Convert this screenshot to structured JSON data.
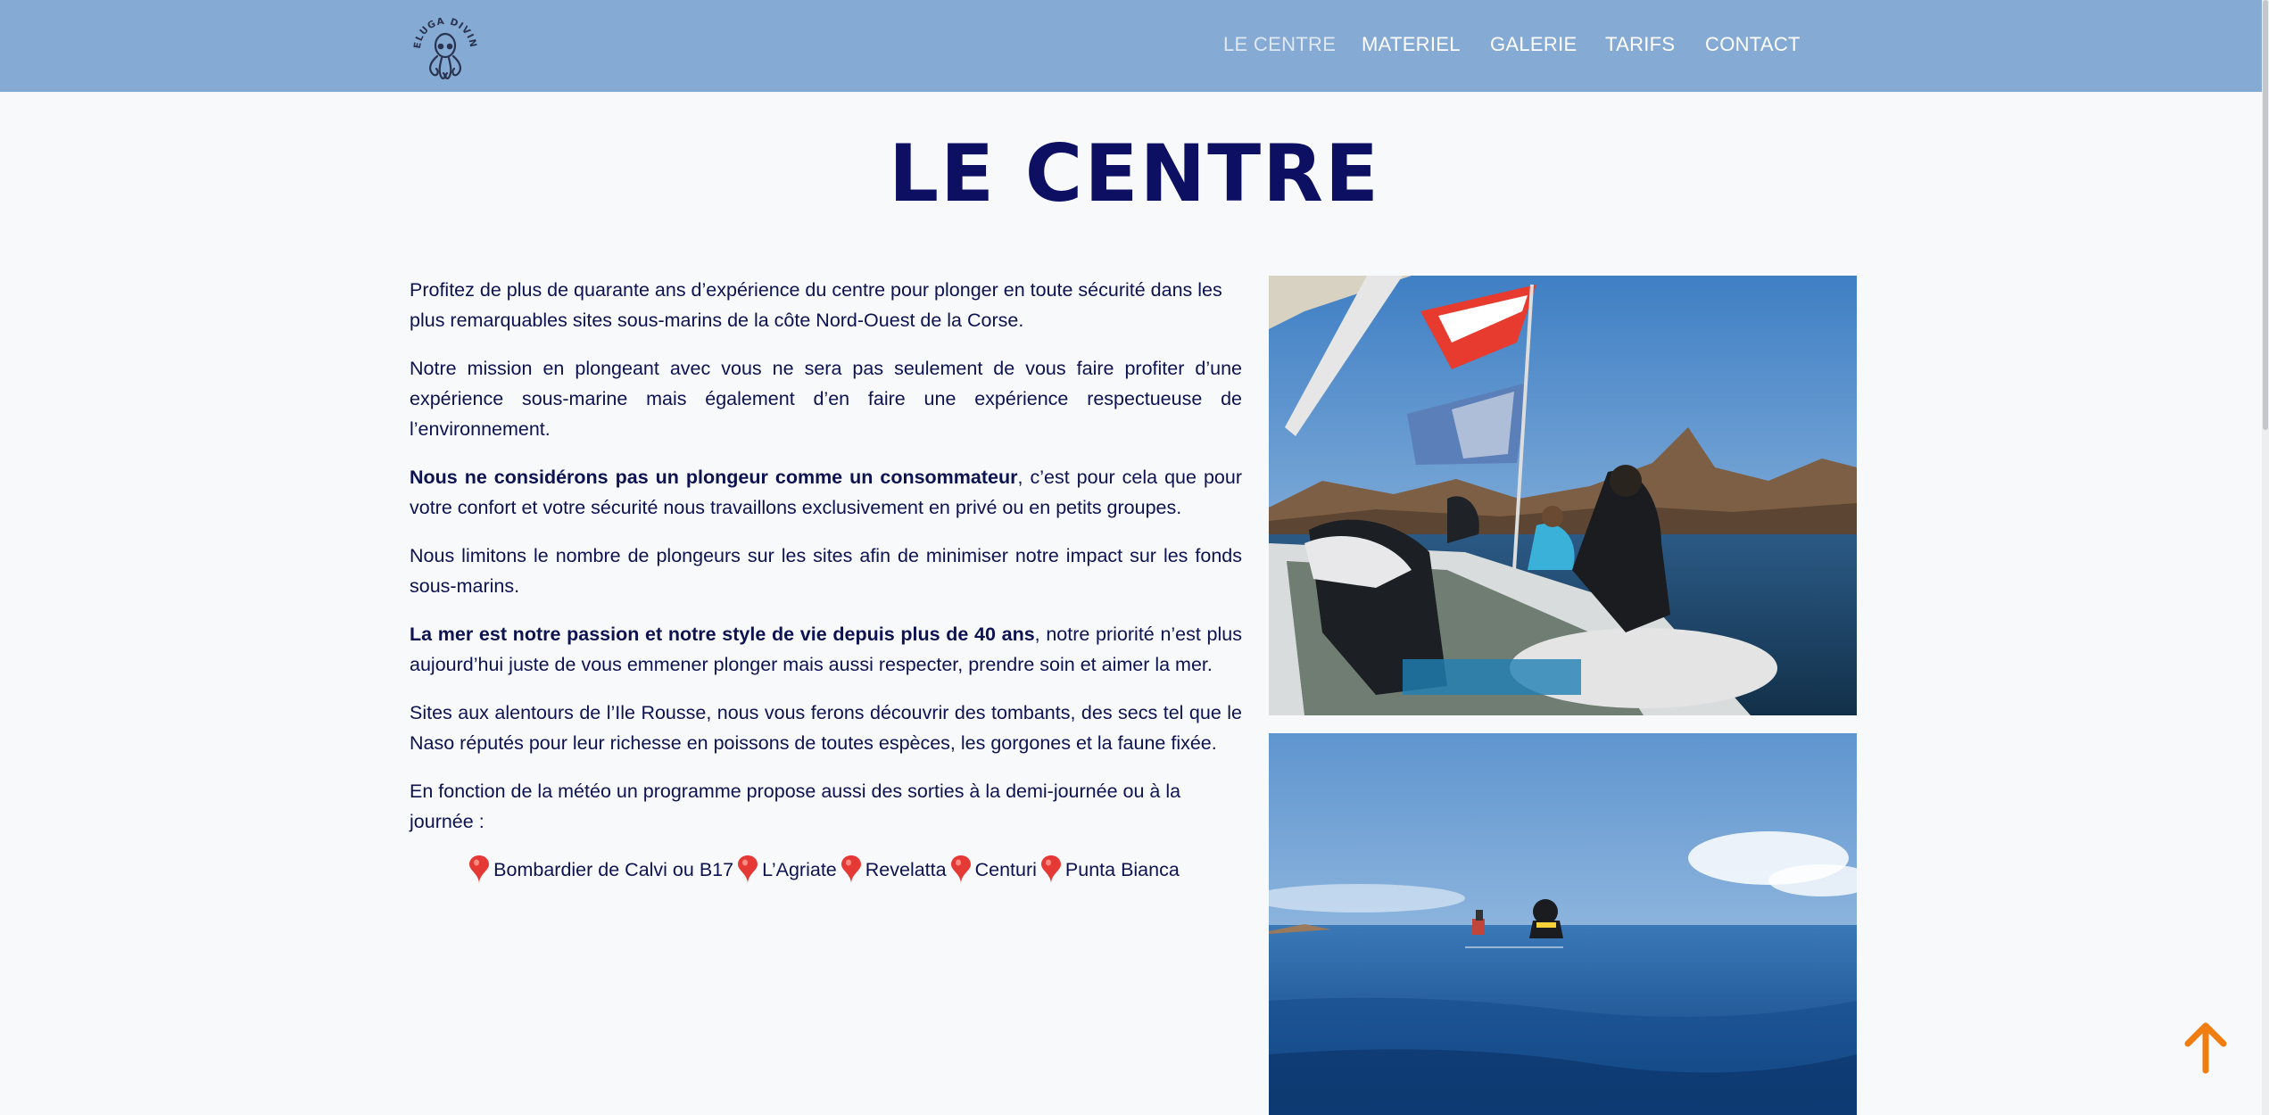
{
  "header": {
    "logo_text": "BELUGA DIVING",
    "nav": [
      {
        "label": "LE CENTRE",
        "active": true
      },
      {
        "label": "MATERIEL",
        "active": false
      },
      {
        "label": "GALERIE",
        "active": false
      },
      {
        "label": "TARIFS",
        "active": false
      },
      {
        "label": "CONTACT",
        "active": false
      }
    ]
  },
  "main": {
    "title": "LE CENTRE",
    "paragraphs": {
      "p1": "Profitez de plus de quarante ans d’expérience du centre pour plonger en toute sécurité dans les plus remarquables sites sous-marins de la côte Nord-Ouest de la Corse.",
      "p2": "Notre mission en plongeant avec vous ne sera pas seulement de vous faire profiter d’une expérience sous-marine mais également d’en faire une expérience respectueuse de l’environnement.",
      "p3_bold": "Nous ne considérons pas un plongeur comme un consommateur",
      "p3_rest": ", c’est pour cela que pour votre confort et votre sécurité nous travaillons exclusivement en privé ou en petits groupes.",
      "p4": "Nous limitons le nombre de plongeurs sur les sites afin de minimiser notre impact sur les fonds sous-marins.",
      "p5_bold": "La mer est notre passion et notre style de vie depuis plus de 40 ans",
      "p5_rest": ", notre priorité n’est plus aujourd’hui juste de vous emmener plonger mais aussi respecter, prendre soin et aimer la mer.",
      "p6": "Sites aux alentours de l’Ile Rousse, nous vous ferons découvrir des tombants, des secs tel que le Naso réputés pour leur richesse en poissons de toutes espèces, les gorgones et la faune fixée.",
      "p7": "En fonction de la météo un programme propose aussi des sorties à la demi-journée ou à la journée :"
    },
    "sites": [
      "Bombardier de Calvi ou B17",
      "L’Agriate",
      "Revelatta",
      "Centuri",
      "Punta Bianca"
    ],
    "photos": [
      {
        "icon": "boat-divers-photo"
      },
      {
        "icon": "diver-surface-photo"
      }
    ]
  },
  "colors": {
    "header_bg": "#85aad4",
    "title": "#0d0f63",
    "text": "#0d1250",
    "back_to_top": "#f07d10",
    "pin": "#e53935"
  },
  "back_to_top_icon": "arrow-up-icon"
}
